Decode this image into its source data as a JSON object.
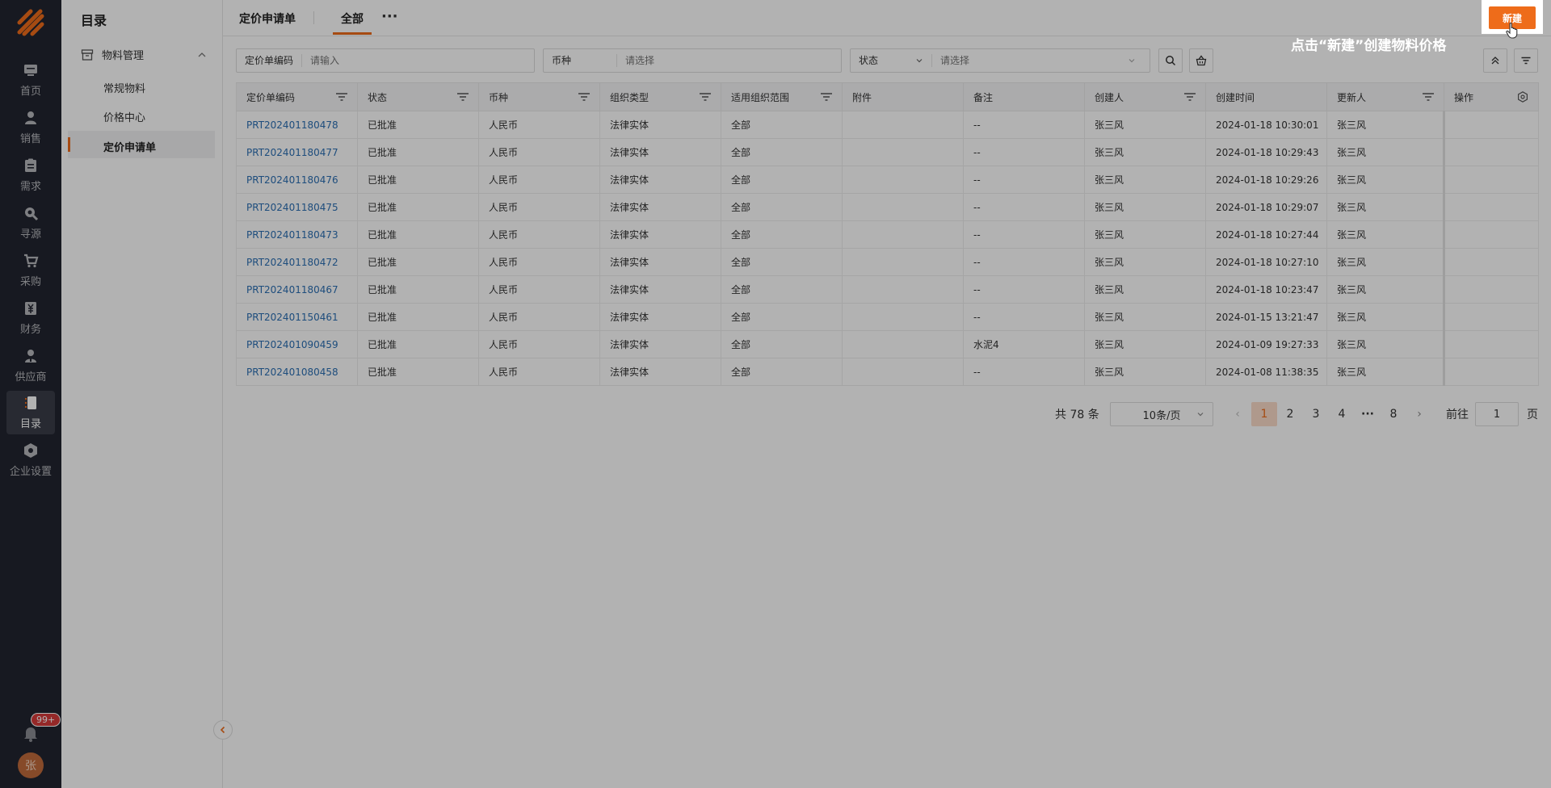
{
  "nav": {
    "items": [
      {
        "label": "首页",
        "icon": "monitor-icon"
      },
      {
        "label": "销售",
        "icon": "person-icon"
      },
      {
        "label": "需求",
        "icon": "clipboard-icon"
      },
      {
        "label": "寻源",
        "icon": "search-icon"
      },
      {
        "label": "采购",
        "icon": "cart-icon"
      },
      {
        "label": "财务",
        "icon": "finance-icon"
      },
      {
        "label": "供应商",
        "icon": "supplier-icon"
      },
      {
        "label": "目录",
        "icon": "catalog-icon"
      },
      {
        "label": "企业设置",
        "icon": "settings-icon"
      }
    ],
    "badge": "99+",
    "avatar": "张"
  },
  "sidebar": {
    "title": "目录",
    "group": "物料管理",
    "items": [
      "常规物料",
      "价格中心",
      "定价申请单"
    ]
  },
  "header": {
    "title": "定价申请单",
    "tab": "全部",
    "more": "···"
  },
  "filters": {
    "code": {
      "label": "定价单编码",
      "placeholder": "请输入"
    },
    "currency": {
      "label": "币种",
      "placeholder": "请选择"
    },
    "status": {
      "label": "状态",
      "placeholder": "请选择"
    }
  },
  "table": {
    "columns": [
      "定价单编码",
      "状态",
      "币种",
      "组织类型",
      "适用组织范围",
      "附件",
      "备注",
      "创建人",
      "创建时间",
      "更新人",
      "操作"
    ],
    "rows": [
      [
        "PRT202401180478",
        "已批准",
        "人民币",
        "法律实体",
        "全部",
        "",
        "--",
        "张三风",
        "2024-01-18 10:30:01",
        "张三风",
        ""
      ],
      [
        "PRT202401180477",
        "已批准",
        "人民币",
        "法律实体",
        "全部",
        "",
        "--",
        "张三风",
        "2024-01-18 10:29:43",
        "张三风",
        ""
      ],
      [
        "PRT202401180476",
        "已批准",
        "人民币",
        "法律实体",
        "全部",
        "",
        "--",
        "张三风",
        "2024-01-18 10:29:26",
        "张三风",
        ""
      ],
      [
        "PRT202401180475",
        "已批准",
        "人民币",
        "法律实体",
        "全部",
        "",
        "--",
        "张三风",
        "2024-01-18 10:29:07",
        "张三风",
        ""
      ],
      [
        "PRT202401180473",
        "已批准",
        "人民币",
        "法律实体",
        "全部",
        "",
        "--",
        "张三风",
        "2024-01-18 10:27:44",
        "张三风",
        ""
      ],
      [
        "PRT202401180472",
        "已批准",
        "人民币",
        "法律实体",
        "全部",
        "",
        "--",
        "张三风",
        "2024-01-18 10:27:10",
        "张三风",
        ""
      ],
      [
        "PRT202401180467",
        "已批准",
        "人民币",
        "法律实体",
        "全部",
        "",
        "--",
        "张三风",
        "2024-01-18 10:23:47",
        "张三风",
        ""
      ],
      [
        "PRT202401150461",
        "已批准",
        "人民币",
        "法律实体",
        "全部",
        "",
        "--",
        "张三风",
        "2024-01-15 13:21:47",
        "张三风",
        ""
      ],
      [
        "PRT202401090459",
        "已批准",
        "人民币",
        "法律实体",
        "全部",
        "",
        "水泥4",
        "张三风",
        "2024-01-09 19:27:33",
        "张三风",
        ""
      ],
      [
        "PRT202401080458",
        "已批准",
        "人民币",
        "法律实体",
        "全部",
        "",
        "--",
        "张三风",
        "2024-01-08 11:38:35",
        "张三风",
        ""
      ]
    ]
  },
  "pagination": {
    "total": "共 78 条",
    "page_size": "10条/页",
    "pages": [
      "1",
      "2",
      "3",
      "4",
      "···",
      "8"
    ],
    "current": "1",
    "goto_label": "前往",
    "goto_value": "1",
    "page_suffix": "页"
  },
  "guide": {
    "button": "新建",
    "hint": "点击“新建”创建物料价格"
  },
  "colors": {
    "accent": "#ee6c1a",
    "link": "#2b6fb3",
    "rail": "#222530"
  }
}
